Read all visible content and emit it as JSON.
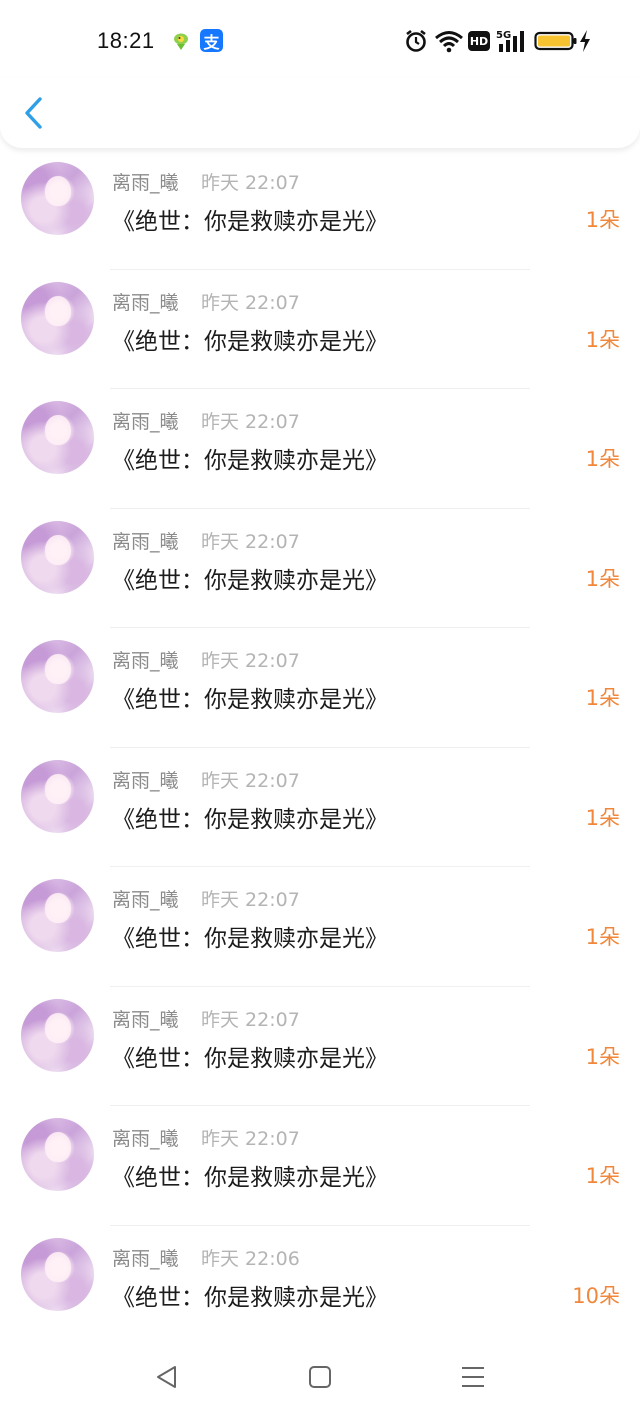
{
  "status_bar": {
    "time": "18:21",
    "alipay_label": "支",
    "network_label": "5G",
    "hd_label": "HD",
    "icons": [
      "bird-app-icon",
      "alipay-icon",
      "alarm-icon",
      "wifi-icon",
      "hd-icon",
      "signal-icon",
      "battery-icon",
      "charging-icon"
    ]
  },
  "header": {
    "back_icon": "chevron-left-icon",
    "accent_color": "#2f9fe6"
  },
  "rows": [
    {
      "username": "离雨_曦",
      "time": "昨天 22:07",
      "title": "《绝世：你是救赎亦是光》",
      "count": "1朵"
    },
    {
      "username": "离雨_曦",
      "time": "昨天 22:07",
      "title": "《绝世：你是救赎亦是光》",
      "count": "1朵"
    },
    {
      "username": "离雨_曦",
      "time": "昨天 22:07",
      "title": "《绝世：你是救赎亦是光》",
      "count": "1朵"
    },
    {
      "username": "离雨_曦",
      "time": "昨天 22:07",
      "title": "《绝世：你是救赎亦是光》",
      "count": "1朵"
    },
    {
      "username": "离雨_曦",
      "time": "昨天 22:07",
      "title": "《绝世：你是救赎亦是光》",
      "count": "1朵"
    },
    {
      "username": "离雨_曦",
      "time": "昨天 22:07",
      "title": "《绝世：你是救赎亦是光》",
      "count": "1朵"
    },
    {
      "username": "离雨_曦",
      "time": "昨天 22:07",
      "title": "《绝世：你是救赎亦是光》",
      "count": "1朵"
    },
    {
      "username": "离雨_曦",
      "time": "昨天 22:07",
      "title": "《绝世：你是救赎亦是光》",
      "count": "1朵"
    },
    {
      "username": "离雨_曦",
      "time": "昨天 22:07",
      "title": "《绝世：你是救赎亦是光》",
      "count": "1朵"
    },
    {
      "username": "离雨_曦",
      "time": "昨天 22:06",
      "title": "《绝世：你是救赎亦是光》",
      "count": "10朵"
    }
  ],
  "colors": {
    "count_color": "#f0873a",
    "username_color": "#8a8a8a",
    "timestamp_color": "#b4b4b4"
  },
  "nav_bar": {
    "icons": [
      "back-triangle-icon",
      "home-square-icon",
      "menu-lines-icon"
    ]
  }
}
